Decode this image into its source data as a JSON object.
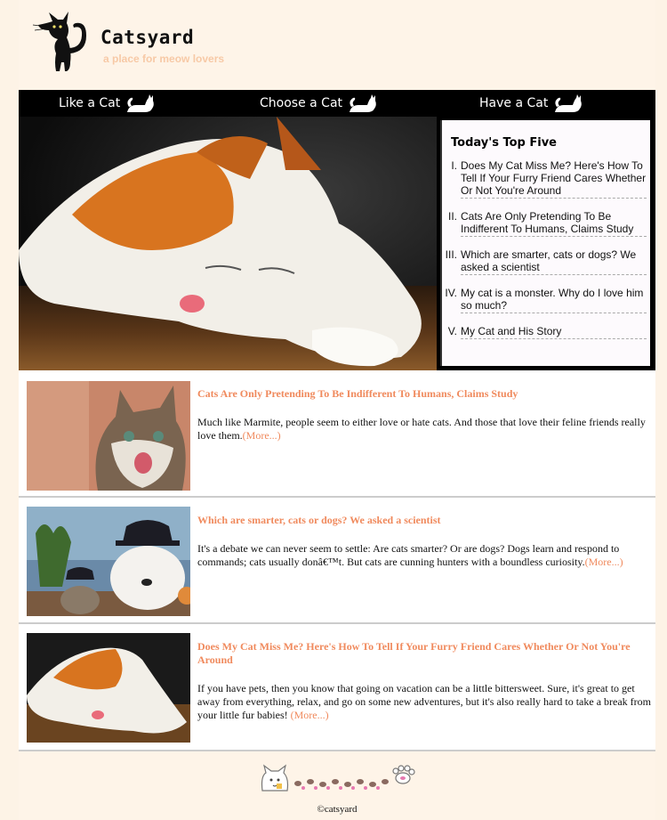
{
  "header": {
    "site_title": "Catsyard",
    "tagline": "a place for meow lovers"
  },
  "nav": {
    "items": [
      {
        "label": "Like a Cat"
      },
      {
        "label": "Choose a Cat"
      },
      {
        "label": "Have a Cat"
      }
    ]
  },
  "top_five": {
    "title": "Today's Top Five",
    "items": [
      {
        "num": "I.",
        "text": "Does My Cat Miss Me? Here's How To Tell If Your Furry Friend Cares Whether Or Not You're Around"
      },
      {
        "num": "II.",
        "text": "Cats Are Only Pretending To Be Indifferent To Humans, Claims Study"
      },
      {
        "num": "III.",
        "text": "Which are smarter, cats or dogs? We asked a scientist"
      },
      {
        "num": "IV.",
        "text": "My cat is a monster. Why do I love him so much?"
      },
      {
        "num": "V.",
        "text": "My Cat and His Story"
      }
    ]
  },
  "articles": [
    {
      "title": "Cats Are Only Pretending To Be Indifferent To Humans, Claims Study",
      "body": "Much like Marmite, people seem to either love or hate cats. And those that love their feline friends really love them.",
      "more": "(More...)"
    },
    {
      "title": "Which are smarter, cats or dogs? We asked a scientist",
      "body": "It's a debate we can never seem to settle: Are cats smarter? Or are dogs? Dogs learn and respond to commands; cats usually donâ€™t. But cats are cunning hunters with a boundless curiosity.",
      "more": "(More...)"
    },
    {
      "title": "Does My Cat Miss Me? Here's How To Tell If Your Furry Friend Cares Whether Or Not You're Around",
      "body": "If you have pets, then you know that going on vacation can be a little bittersweet. Sure, it's great to get away from everything, relax, and go on some new adventures, but it's also really hard to take a break from your little fur babies! ",
      "more": "(More...)"
    }
  ],
  "footer": {
    "copyright": "©catsyard"
  },
  "colors": {
    "accent": "#f08a5d",
    "tagline": "#f7c9a6",
    "background": "#fef4e8",
    "nav": "#000000"
  }
}
